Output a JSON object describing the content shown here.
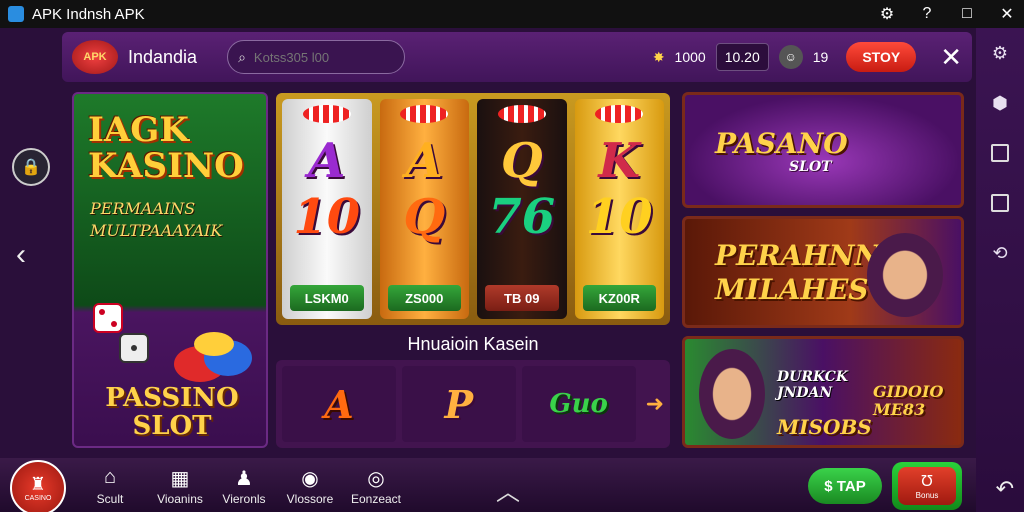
{
  "window": {
    "title": "APK Indnsh APK",
    "controls": [
      "⚙",
      "?",
      "□",
      "✕"
    ]
  },
  "header": {
    "logo_text": "APK",
    "brand": "Indandia",
    "search_placeholder": "Kotss305 l00",
    "coins": "1000",
    "balance": "10.20",
    "level": "19",
    "stop_label": "STOY"
  },
  "left_banner": {
    "title": "IAGK KASINO",
    "subtitle": "PERMAAINS MULTPAAAYAIK",
    "bottom": "PASSINO SLOT"
  },
  "slot": {
    "reels": [
      {
        "top": "A",
        "middle": "10",
        "label": "LSKM0",
        "color": "#9a2ad0",
        "mid_color": "#ff4a10"
      },
      {
        "top": "A",
        "middle": "Q",
        "label": "ZS000",
        "color": "#ffb020",
        "mid_color": "#ff6a10"
      },
      {
        "top": "Q",
        "middle": "76",
        "label": "TB 09",
        "color": "#ffc83a",
        "mid_color": "#1ad080"
      },
      {
        "top": "K",
        "middle": "10",
        "label": "KZ00R",
        "color": "#d02a4a",
        "mid_color": "#ffd020"
      }
    ]
  },
  "section_title": "Hnuaioin Kasein",
  "game_tiles": [
    {
      "label": "A",
      "color": "#ff6a10"
    },
    {
      "label": "P",
      "color": "#ffb040"
    },
    {
      "label": "Guo",
      "color": "#3ad24a"
    }
  ],
  "promos": {
    "p1_title": "PASANO",
    "p1_sub": "SLOT",
    "p2_title": "PERAHNN MILAHES",
    "p3_a": "DURKCK JNDAN",
    "p3_b": "MISOBS",
    "p3_c": "GIDOIO ME83"
  },
  "bottom_nav": {
    "home_label": "CASINO",
    "items": [
      {
        "label": "Scult",
        "icon": "⌂"
      },
      {
        "label": "Vioanins",
        "icon": "▦"
      },
      {
        "label": "Vieronls",
        "icon": "♟"
      },
      {
        "label": "Vlossore",
        "icon": "◉"
      },
      {
        "label": "Eonzeact",
        "icon": "◎"
      }
    ],
    "tap_label": "$ TAP",
    "gift_label": "Bonus"
  },
  "sidebar": {
    "icons": [
      "gear-icon",
      "shield-icon",
      "square-icon",
      "square-icon",
      "back-icon"
    ]
  }
}
